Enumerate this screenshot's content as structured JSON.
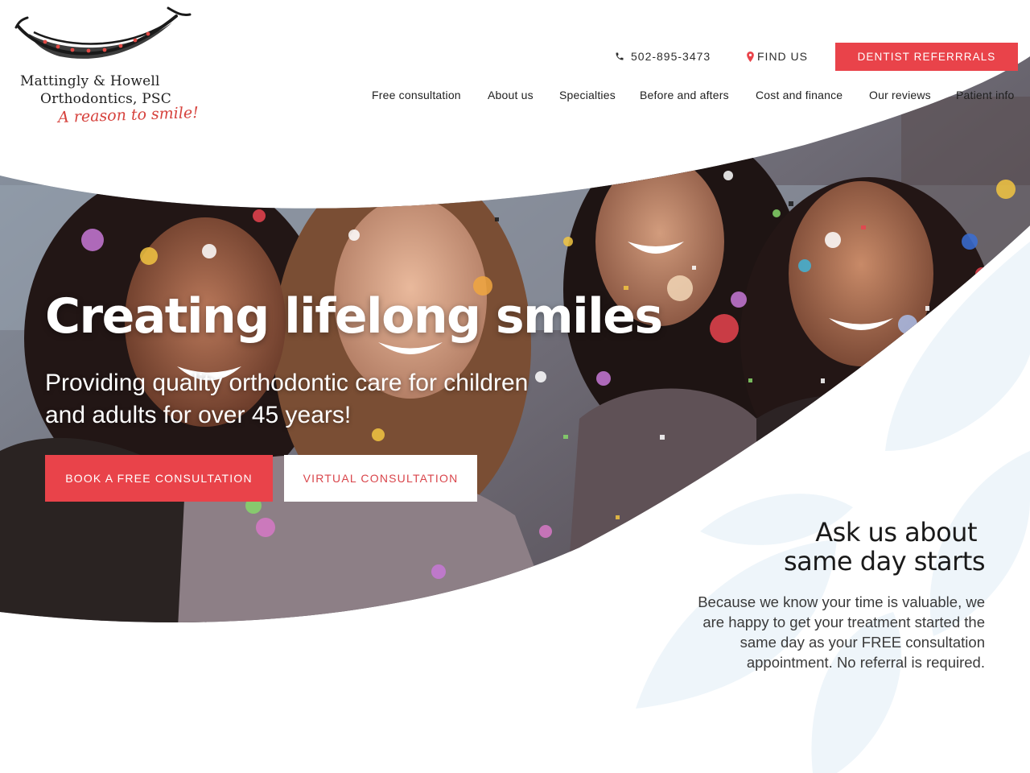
{
  "brand": {
    "name_line1": "Mattingly & Howell",
    "name_line2": "Orthodontics, PSC",
    "tagline": "A reason to smile!",
    "accent_color": "#e9434a"
  },
  "header": {
    "phone": "502-895-3473",
    "phone_icon": "phone-icon",
    "find_us": "FIND US",
    "find_us_icon": "map-pin-icon",
    "referral_button": "DENTIST REFERRRALS"
  },
  "nav": {
    "items": [
      {
        "label": "Free consultation"
      },
      {
        "label": "About us"
      },
      {
        "label": "Specialties"
      },
      {
        "label": "Before and afters"
      },
      {
        "label": "Cost and finance"
      },
      {
        "label": "Our reviews"
      },
      {
        "label": "Patient info"
      }
    ]
  },
  "hero": {
    "title": "Creating lifelong smiles",
    "subtitle": "Providing quality orthodontic care for children and adults for over 45 years!",
    "cta_primary": "BOOK A FREE CONSULTATION",
    "cta_secondary": "VIRTUAL CONSULTATION",
    "image_subject": "four smiling women with falling confetti"
  },
  "same_day": {
    "title_line1": "Ask us about",
    "title_line2": "same day starts",
    "body": "Because we know your time is valuable, we are happy to get your treatment started the same day as your FREE consultation appointment. No referral is required."
  }
}
